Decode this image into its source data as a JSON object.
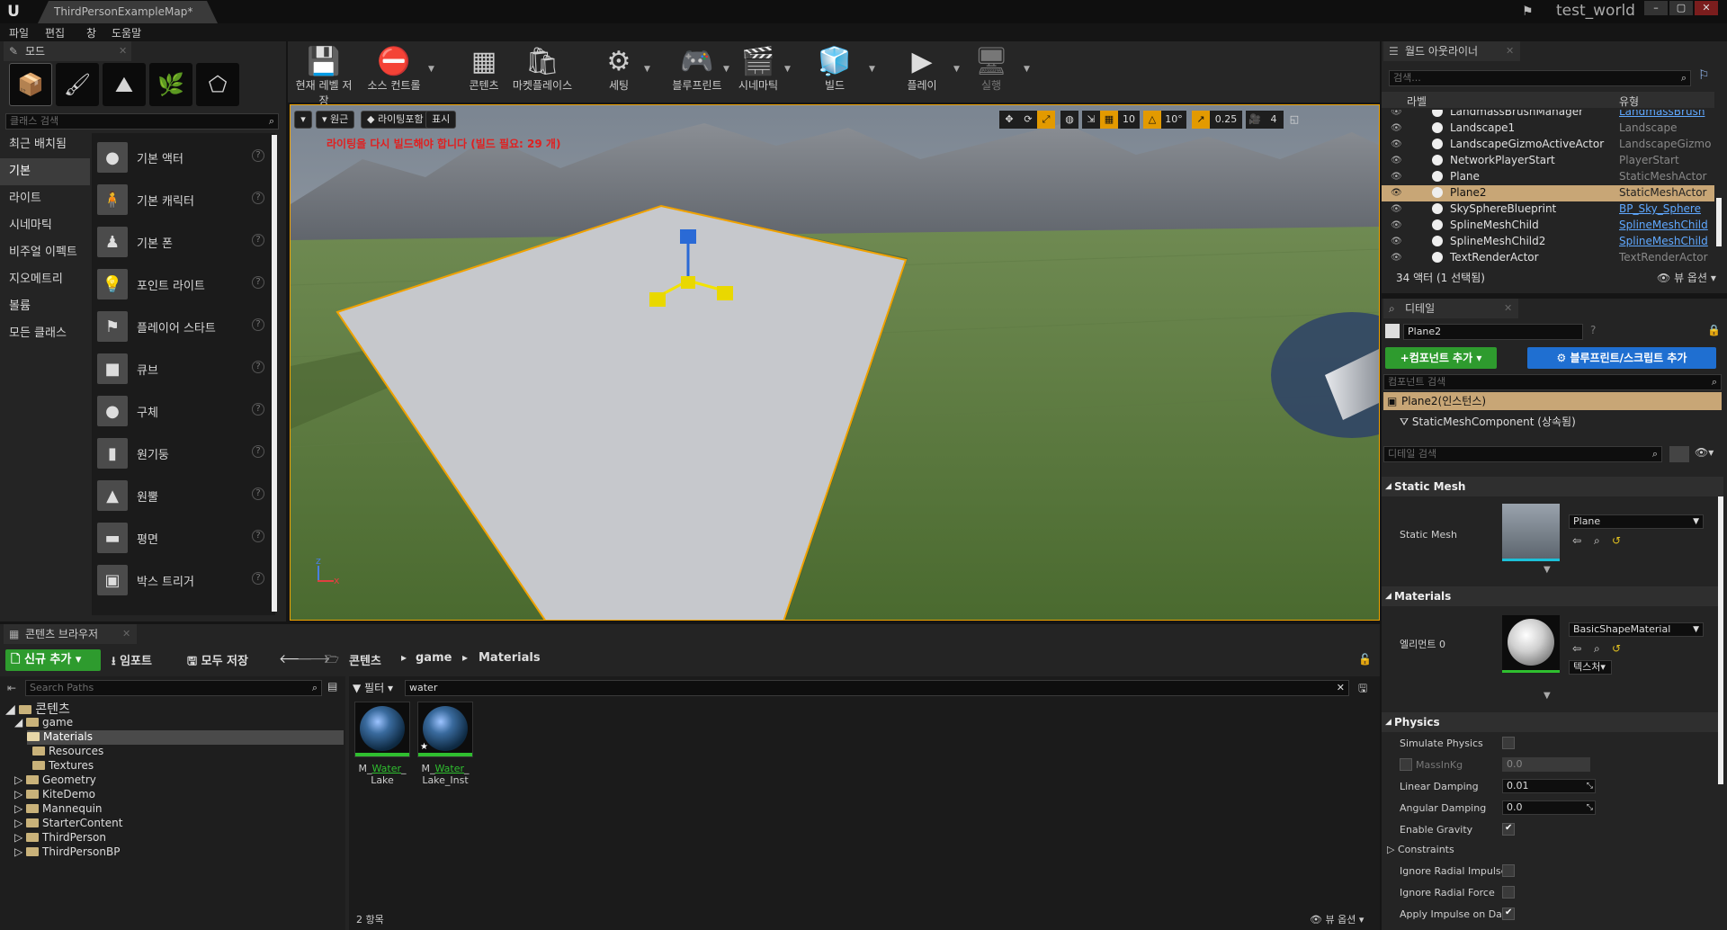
{
  "title_bar": {
    "logo": "U",
    "doc_tab": "ThirdPersonExampleMap*",
    "world_name": "test_world"
  },
  "menu": [
    "파일",
    "편집",
    "창",
    "도움말"
  ],
  "modes": {
    "tab": "모드",
    "search_placeholder": "클래스 검색",
    "categories": [
      "최근 배치됨",
      "기본",
      "라이트",
      "시네마틱",
      "비주얼 이펙트",
      "지오메트리",
      "볼륨",
      "모든 클래스"
    ],
    "selected_category": "기본",
    "items": [
      "기본 액터",
      "기본 캐릭터",
      "기본 폰",
      "포인트 라이트",
      "플레이어 스타트",
      "큐브",
      "구체",
      "원기둥",
      "원뿔",
      "평면",
      "박스 트리거"
    ],
    "help_glyph": "?"
  },
  "toolbar": {
    "buttons": [
      {
        "label": "현재 레벨 저장",
        "icon": "save-icon"
      },
      {
        "label": "소스 컨트롤",
        "icon": "source-control-icon"
      },
      {
        "label": "콘텐츠",
        "icon": "content-icon"
      },
      {
        "label": "마켓플레이스",
        "icon": "marketplace-icon"
      },
      {
        "label": "세팅",
        "icon": "settings-icon"
      },
      {
        "label": "블루프린트",
        "icon": "blueprint-icon"
      },
      {
        "label": "시네마틱",
        "icon": "cinematic-icon"
      },
      {
        "label": "빌드",
        "icon": "build-icon"
      },
      {
        "label": "플레이",
        "icon": "play-icon"
      },
      {
        "label": "실행",
        "icon": "launch-icon"
      }
    ]
  },
  "viewport": {
    "perspective": "원근",
    "lighting": "라이팅포함",
    "show": "표시",
    "warning": "라이팅을 다시 빌드해야 합니다 (빌드 필요: 29 개)",
    "grid_snap": "10",
    "rot_snap": "10°",
    "scale_snap": "0.25",
    "cam_speed": "4",
    "axis_z": "z",
    "axis_x": "x"
  },
  "outliner": {
    "tab": "월드 아웃라이너",
    "search_placeholder": "검색...",
    "col_label": "라벨",
    "col_type": "유형",
    "rows": [
      {
        "name": "LandmassBrushManager",
        "type": "LandmassBrush",
        "link": true
      },
      {
        "name": "Landscape1",
        "type": "Landscape",
        "link": false
      },
      {
        "name": "LandscapeGizmoActiveActor",
        "type": "LandscapeGizmo",
        "link": false
      },
      {
        "name": "NetworkPlayerStart",
        "type": "PlayerStart",
        "link": false
      },
      {
        "name": "Plane",
        "type": "StaticMeshActor",
        "link": false
      },
      {
        "name": "Plane2",
        "type": "StaticMeshActor",
        "link": false
      },
      {
        "name": "SkySphereBlueprint",
        "type": "BP_Sky_Sphere",
        "link": true
      },
      {
        "name": "SplineMeshChild",
        "type": "SplineMeshChild",
        "link": true
      },
      {
        "name": "SplineMeshChild2",
        "type": "SplineMeshChild",
        "link": true
      },
      {
        "name": "TextRenderActor",
        "type": "TextRenderActor",
        "link": false
      }
    ],
    "selected_row": "Plane2",
    "status": "34 액터 (1 선택됨)",
    "view_options": "뷰 옵션"
  },
  "details": {
    "tab": "디테일",
    "name_value": "Plane2",
    "add_component": "+컴포넌트 추가",
    "blueprint_script": "블루프린트/스크립트 추가",
    "component_search_placeholder": "컴포넌트 검색",
    "instance": "Plane2(인스턴스)",
    "component": "StaticMeshComponent (상속됨)",
    "detail_search_placeholder": "디테일 검색",
    "sections": {
      "static_mesh": {
        "title": "Static Mesh",
        "label": "Static Mesh",
        "value": "Plane"
      },
      "materials": {
        "title": "Materials",
        "label": "엘리먼트 0",
        "value": "BasicShapeMaterial",
        "texture_btn": "텍스처"
      },
      "physics": {
        "title": "Physics",
        "props": [
          {
            "label": "Simulate Physics",
            "kind": "check",
            "checked": false
          },
          {
            "label": "MassInKg",
            "kind": "value",
            "value": "0.0",
            "disabled": true
          },
          {
            "label": "Linear Damping",
            "kind": "value",
            "value": "0.01"
          },
          {
            "label": "Angular Damping",
            "kind": "value",
            "value": "0.0"
          },
          {
            "label": "Enable Gravity",
            "kind": "check",
            "checked": true
          },
          {
            "label": "Constraints",
            "kind": "group"
          },
          {
            "label": "Ignore Radial Impulse",
            "kind": "check",
            "checked": false
          },
          {
            "label": "Ignore Radial Force",
            "kind": "check",
            "checked": false
          },
          {
            "label": "Apply Impulse on Dam",
            "kind": "check",
            "checked": true
          }
        ]
      }
    }
  },
  "content_browser": {
    "tab": "콘텐츠 브라우저",
    "add_new": "신규 추가",
    "import": "임포트",
    "save_all": "모두 저장",
    "path": [
      "콘텐츠",
      "game",
      "Materials"
    ],
    "search_paths_placeholder": "Search Paths",
    "filter_label": "필터",
    "filter_value": "water",
    "tree": [
      {
        "label": "콘텐츠",
        "depth": 0,
        "expanded": true
      },
      {
        "label": "game",
        "depth": 1,
        "expanded": true
      },
      {
        "label": "Materials",
        "depth": 2,
        "selected": true
      },
      {
        "label": "Resources",
        "depth": 2
      },
      {
        "label": "Textures",
        "depth": 2
      },
      {
        "label": "Geometry",
        "depth": 1
      },
      {
        "label": "KiteDemo",
        "depth": 1
      },
      {
        "label": "Mannequin",
        "depth": 1
      },
      {
        "label": "StarterContent",
        "depth": 1
      },
      {
        "label": "ThirdPerson",
        "depth": 1
      },
      {
        "label": "ThirdPersonBP",
        "depth": 1
      }
    ],
    "assets": [
      {
        "pre": "M_",
        "highlight": "Water",
        "post": "_",
        "line2": "Lake"
      },
      {
        "pre": "M_",
        "highlight": "Water",
        "post": "_",
        "line2": "Lake_Inst"
      }
    ],
    "item_count": "2 항목",
    "view_options": "뷰 옵션"
  },
  "colors": {
    "selection_orange": "#f0a200",
    "add_green": "#2e9b2e",
    "blueprint_blue": "#1f6fd1",
    "warning_red": "#e02020",
    "link_blue": "#5fa8ff"
  }
}
